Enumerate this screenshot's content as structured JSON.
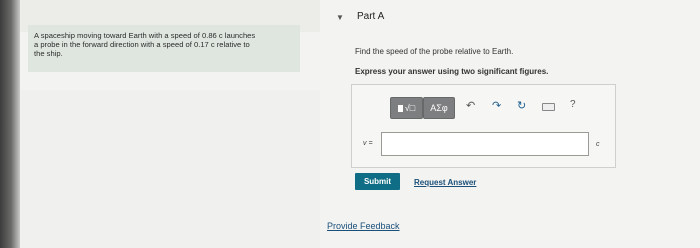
{
  "problem": {
    "lines": [
      "A spaceship moving toward Earth with a speed of 0.86 c launches",
      "a probe in the forward direction with a speed of 0.17 c relative to",
      "the ship."
    ]
  },
  "part": {
    "expand_icon": "triangle-down",
    "title": "Part A"
  },
  "question": "Find the speed of the probe relative to Earth.",
  "instruction": "Express your answer using two significant figures.",
  "toolbar": {
    "templates_label": "√□",
    "symbols_label": "ΑΣφ",
    "undo_icon": "↶",
    "redo_icon": "↷",
    "reset_icon": "↻",
    "keyboard_icon": "keyboard",
    "help_label": "?"
  },
  "answer": {
    "variable": "v =",
    "value": "",
    "unit": "c"
  },
  "submit_label": "Submit",
  "request_answer_label": "Request Answer",
  "feedback_label": "Provide Feedback",
  "colors": {
    "submit": "#0f6e86",
    "link": "#1a4f7a",
    "problem_bg": "#dfe6df"
  }
}
